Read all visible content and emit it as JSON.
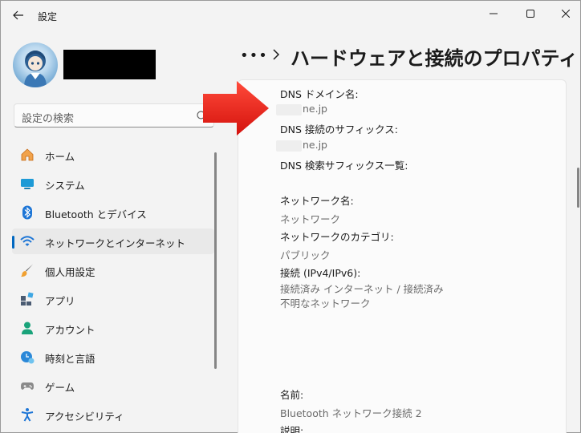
{
  "window": {
    "title": "設定"
  },
  "user": {
    "name": ""
  },
  "search": {
    "placeholder": "設定の検索"
  },
  "nav": {
    "items": [
      {
        "label": "ホーム",
        "icon": "home-icon"
      },
      {
        "label": "システム",
        "icon": "system-icon"
      },
      {
        "label": "Bluetooth とデバイス",
        "icon": "bluetooth-icon"
      },
      {
        "label": "ネットワークとインターネット",
        "icon": "network-icon",
        "selected": true
      },
      {
        "label": "個人用設定",
        "icon": "brush-icon"
      },
      {
        "label": "アプリ",
        "icon": "apps-icon"
      },
      {
        "label": "アカウント",
        "icon": "account-icon"
      },
      {
        "label": "時刻と言語",
        "icon": "time-language-icon"
      },
      {
        "label": "ゲーム",
        "icon": "gamepad-icon"
      },
      {
        "label": "アクセシビリティ",
        "icon": "accessibility-icon"
      }
    ]
  },
  "breadcrumb": {
    "more": "•••",
    "title": "ハードウェアと接続のプロパティ"
  },
  "properties": {
    "dns_domain_label": "DNS ドメイン名:",
    "dns_domain_value": "ne.jp",
    "dns_suffix_label": "DNS 接続のサフィックス:",
    "dns_suffix_value": "ne.jp",
    "dns_search_label": "DNS 検索サフィックス一覧:",
    "network_name_label": "ネットワーク名:",
    "network_name_value": "ネットワーク",
    "network_category_label": "ネットワークのカテゴリ:",
    "network_category_value": "パブリック",
    "connection_label": "接続 (IPv4/IPv6):",
    "connection_value": "接続済み インターネット / 接続済み 不明なネットワーク",
    "name_label": "名前:",
    "name_value": "Bluetooth ネットワーク接続 2",
    "description_label": "説明:"
  },
  "colors": {
    "accent": "#0067c0",
    "arrow": "#e8231f"
  }
}
